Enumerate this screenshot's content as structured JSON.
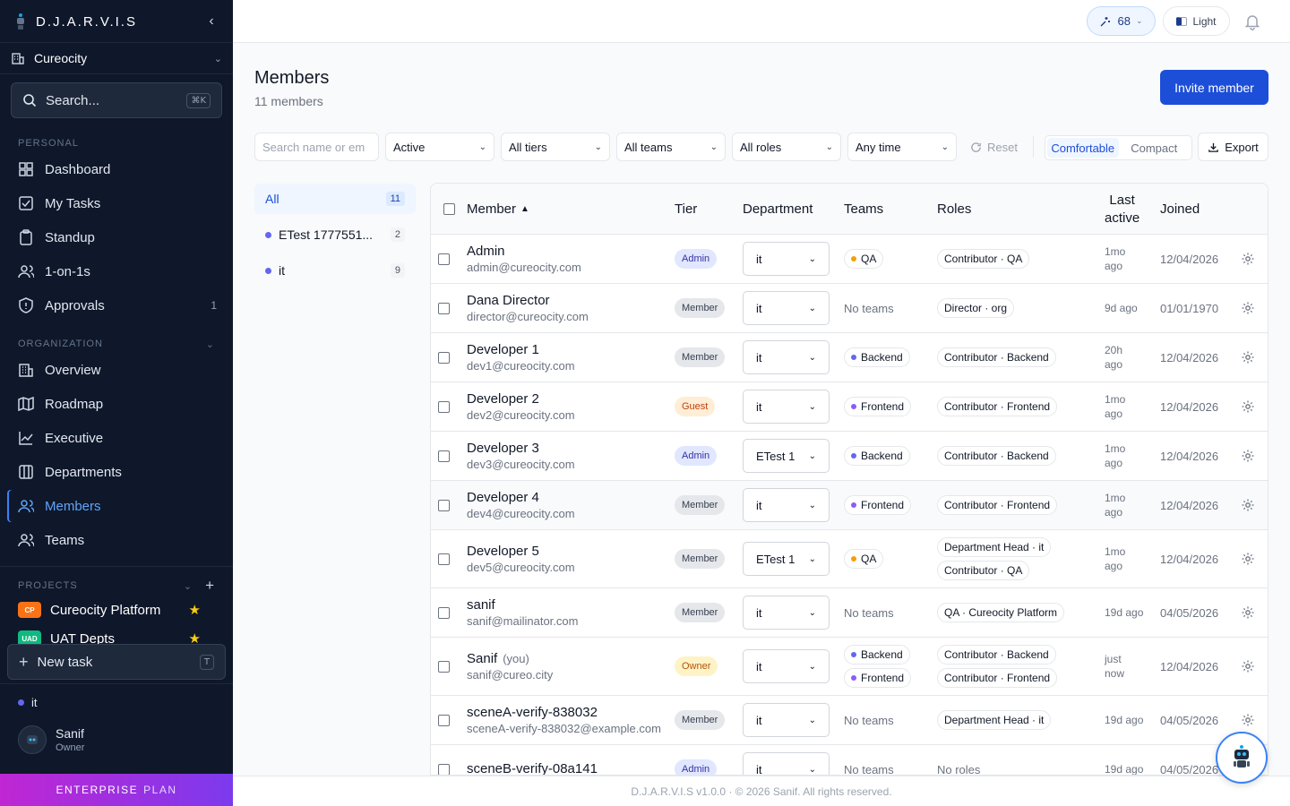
{
  "app": {
    "name": "D.J.A.R.V.I.S",
    "org": "Cureocity"
  },
  "search": {
    "placeholder": "Search...",
    "shortcut": "⌘K"
  },
  "sections": {
    "personal": "PERSONAL",
    "organization": "ORGANIZATION",
    "projects": "PROJECTS"
  },
  "nav_personal": [
    {
      "label": "Dashboard",
      "icon": "dashboard-icon"
    },
    {
      "label": "My Tasks",
      "icon": "tasks-icon"
    },
    {
      "label": "Standup",
      "icon": "clipboard-icon"
    },
    {
      "label": "1-on-1s",
      "icon": "people-icon"
    },
    {
      "label": "Approvals",
      "icon": "shield-icon",
      "badge": "1"
    }
  ],
  "nav_org": [
    {
      "label": "Overview",
      "icon": "building-icon"
    },
    {
      "label": "Roadmap",
      "icon": "map-icon"
    },
    {
      "label": "Executive",
      "icon": "chart-icon"
    },
    {
      "label": "Departments",
      "icon": "columns-icon"
    },
    {
      "label": "Members",
      "icon": "users-icon",
      "active": true
    },
    {
      "label": "Teams",
      "icon": "team-icon"
    }
  ],
  "projects": [
    {
      "code": "CP",
      "name": "Cureocity Platform",
      "color": "#f97316"
    },
    {
      "code": "UAD",
      "name": "UAT Depts",
      "color": "#10b981"
    }
  ],
  "new_task": {
    "label": "New task",
    "shortcut": "T"
  },
  "current_department": "it",
  "user": {
    "name": "Sanif",
    "role": "Owner"
  },
  "plan": {
    "tier": "ENTERPRISE",
    "word": "PLAN"
  },
  "topbar": {
    "credits": "68",
    "theme": "Light"
  },
  "page": {
    "title": "Members",
    "subtitle": "11 members",
    "invite": "Invite member"
  },
  "filters": {
    "search_placeholder": "Search name or em",
    "status": "Active",
    "tiers": "All tiers",
    "teams": "All teams",
    "roles": "All roles",
    "time": "Any time",
    "reset": "Reset",
    "density_comfortable": "Comfortable",
    "density_compact": "Compact",
    "export": "Export"
  },
  "departments": [
    {
      "name": "All",
      "count": "11"
    },
    {
      "name": "ETest 1777551...",
      "count": "2"
    },
    {
      "name": "it",
      "count": "9"
    }
  ],
  "table": {
    "headers": {
      "member": "Member",
      "tier": "Tier",
      "department": "Department",
      "teams": "Teams",
      "roles": "Roles",
      "last_active_1": "Last",
      "last_active_2": "active",
      "joined": "Joined"
    },
    "rows": [
      {
        "name": "Admin",
        "email": "admin@cureocity.com",
        "tier": "Admin",
        "dept": "it",
        "teams": [
          {
            "n": "QA",
            "c": "#f59e0b"
          }
        ],
        "roles": [
          "Contributor · QA"
        ],
        "last": [
          "1mo",
          "ago"
        ],
        "joined": "12/04/2026"
      },
      {
        "name": "Dana Director",
        "email": "director@cureocity.com",
        "tier": "Member",
        "dept": "it",
        "teams": [],
        "roles": [
          "Director · org"
        ],
        "last": [
          "9d ago"
        ],
        "joined": "01/01/1970"
      },
      {
        "name": "Developer 1",
        "email": "dev1@cureocity.com",
        "tier": "Member",
        "dept": "it",
        "teams": [
          {
            "n": "Backend",
            "c": "#6366f1"
          }
        ],
        "roles": [
          "Contributor · Backend"
        ],
        "last": [
          "20h",
          "ago"
        ],
        "joined": "12/04/2026"
      },
      {
        "name": "Developer 2",
        "email": "dev2@cureocity.com",
        "tier": "Guest",
        "dept": "it",
        "teams": [
          {
            "n": "Frontend",
            "c": "#8b5cf6"
          }
        ],
        "roles": [
          "Contributor · Frontend"
        ],
        "last": [
          "1mo",
          "ago"
        ],
        "joined": "12/04/2026"
      },
      {
        "name": "Developer 3",
        "email": "dev3@cureocity.com",
        "tier": "Admin",
        "dept": "ETest 1",
        "teams": [
          {
            "n": "Backend",
            "c": "#6366f1"
          }
        ],
        "roles": [
          "Contributor · Backend"
        ],
        "last": [
          "1mo",
          "ago"
        ],
        "joined": "12/04/2026"
      },
      {
        "name": "Developer 4",
        "email": "dev4@cureocity.com",
        "tier": "Member",
        "dept": "it",
        "teams": [
          {
            "n": "Frontend",
            "c": "#8b5cf6"
          }
        ],
        "roles": [
          "Contributor · Frontend"
        ],
        "last": [
          "1mo",
          "ago"
        ],
        "joined": "12/04/2026"
      },
      {
        "name": "Developer 5",
        "email": "dev5@cureocity.com",
        "tier": "Member",
        "dept": "ETest 1",
        "teams": [
          {
            "n": "QA",
            "c": "#f59e0b"
          }
        ],
        "roles": [
          "Department Head · it",
          "Contributor · QA"
        ],
        "last": [
          "1mo",
          "ago"
        ],
        "joined": "12/04/2026"
      },
      {
        "name": "sanif",
        "email": "sanif@mailinator.com",
        "tier": "Member",
        "dept": "it",
        "teams": [],
        "roles": [
          "QA · Cureocity Platform"
        ],
        "last": [
          "19d ago"
        ],
        "joined": "04/05/2026"
      },
      {
        "name": "Sanif",
        "you": "(you)",
        "email": "sanif@cureo.city",
        "tier": "Owner",
        "dept": "it",
        "teams": [
          {
            "n": "Backend",
            "c": "#6366f1"
          },
          {
            "n": "Frontend",
            "c": "#8b5cf6"
          }
        ],
        "roles": [
          "Contributor · Backend",
          "Contributor · Frontend"
        ],
        "last": [
          "just",
          "now"
        ],
        "joined": "12/04/2026"
      },
      {
        "name": "sceneA-verify-838032",
        "email": "sceneA-verify-838032@example.com",
        "tier": "Member",
        "dept": "it",
        "teams": [],
        "roles": [
          "Department Head · it"
        ],
        "last": [
          "19d ago"
        ],
        "joined": "04/05/2026"
      },
      {
        "name": "sceneB-verify-08a141",
        "email": "",
        "tier": "Admin",
        "dept": "it",
        "teams": [],
        "roles": [],
        "last": [
          "19d ago"
        ],
        "joined": "04/05/2026"
      }
    ],
    "no_teams": "No teams",
    "no_roles": "No roles"
  },
  "footer": "D.J.A.R.V.I.S v1.0.0 · © 2026 Sanif. All rights reserved."
}
